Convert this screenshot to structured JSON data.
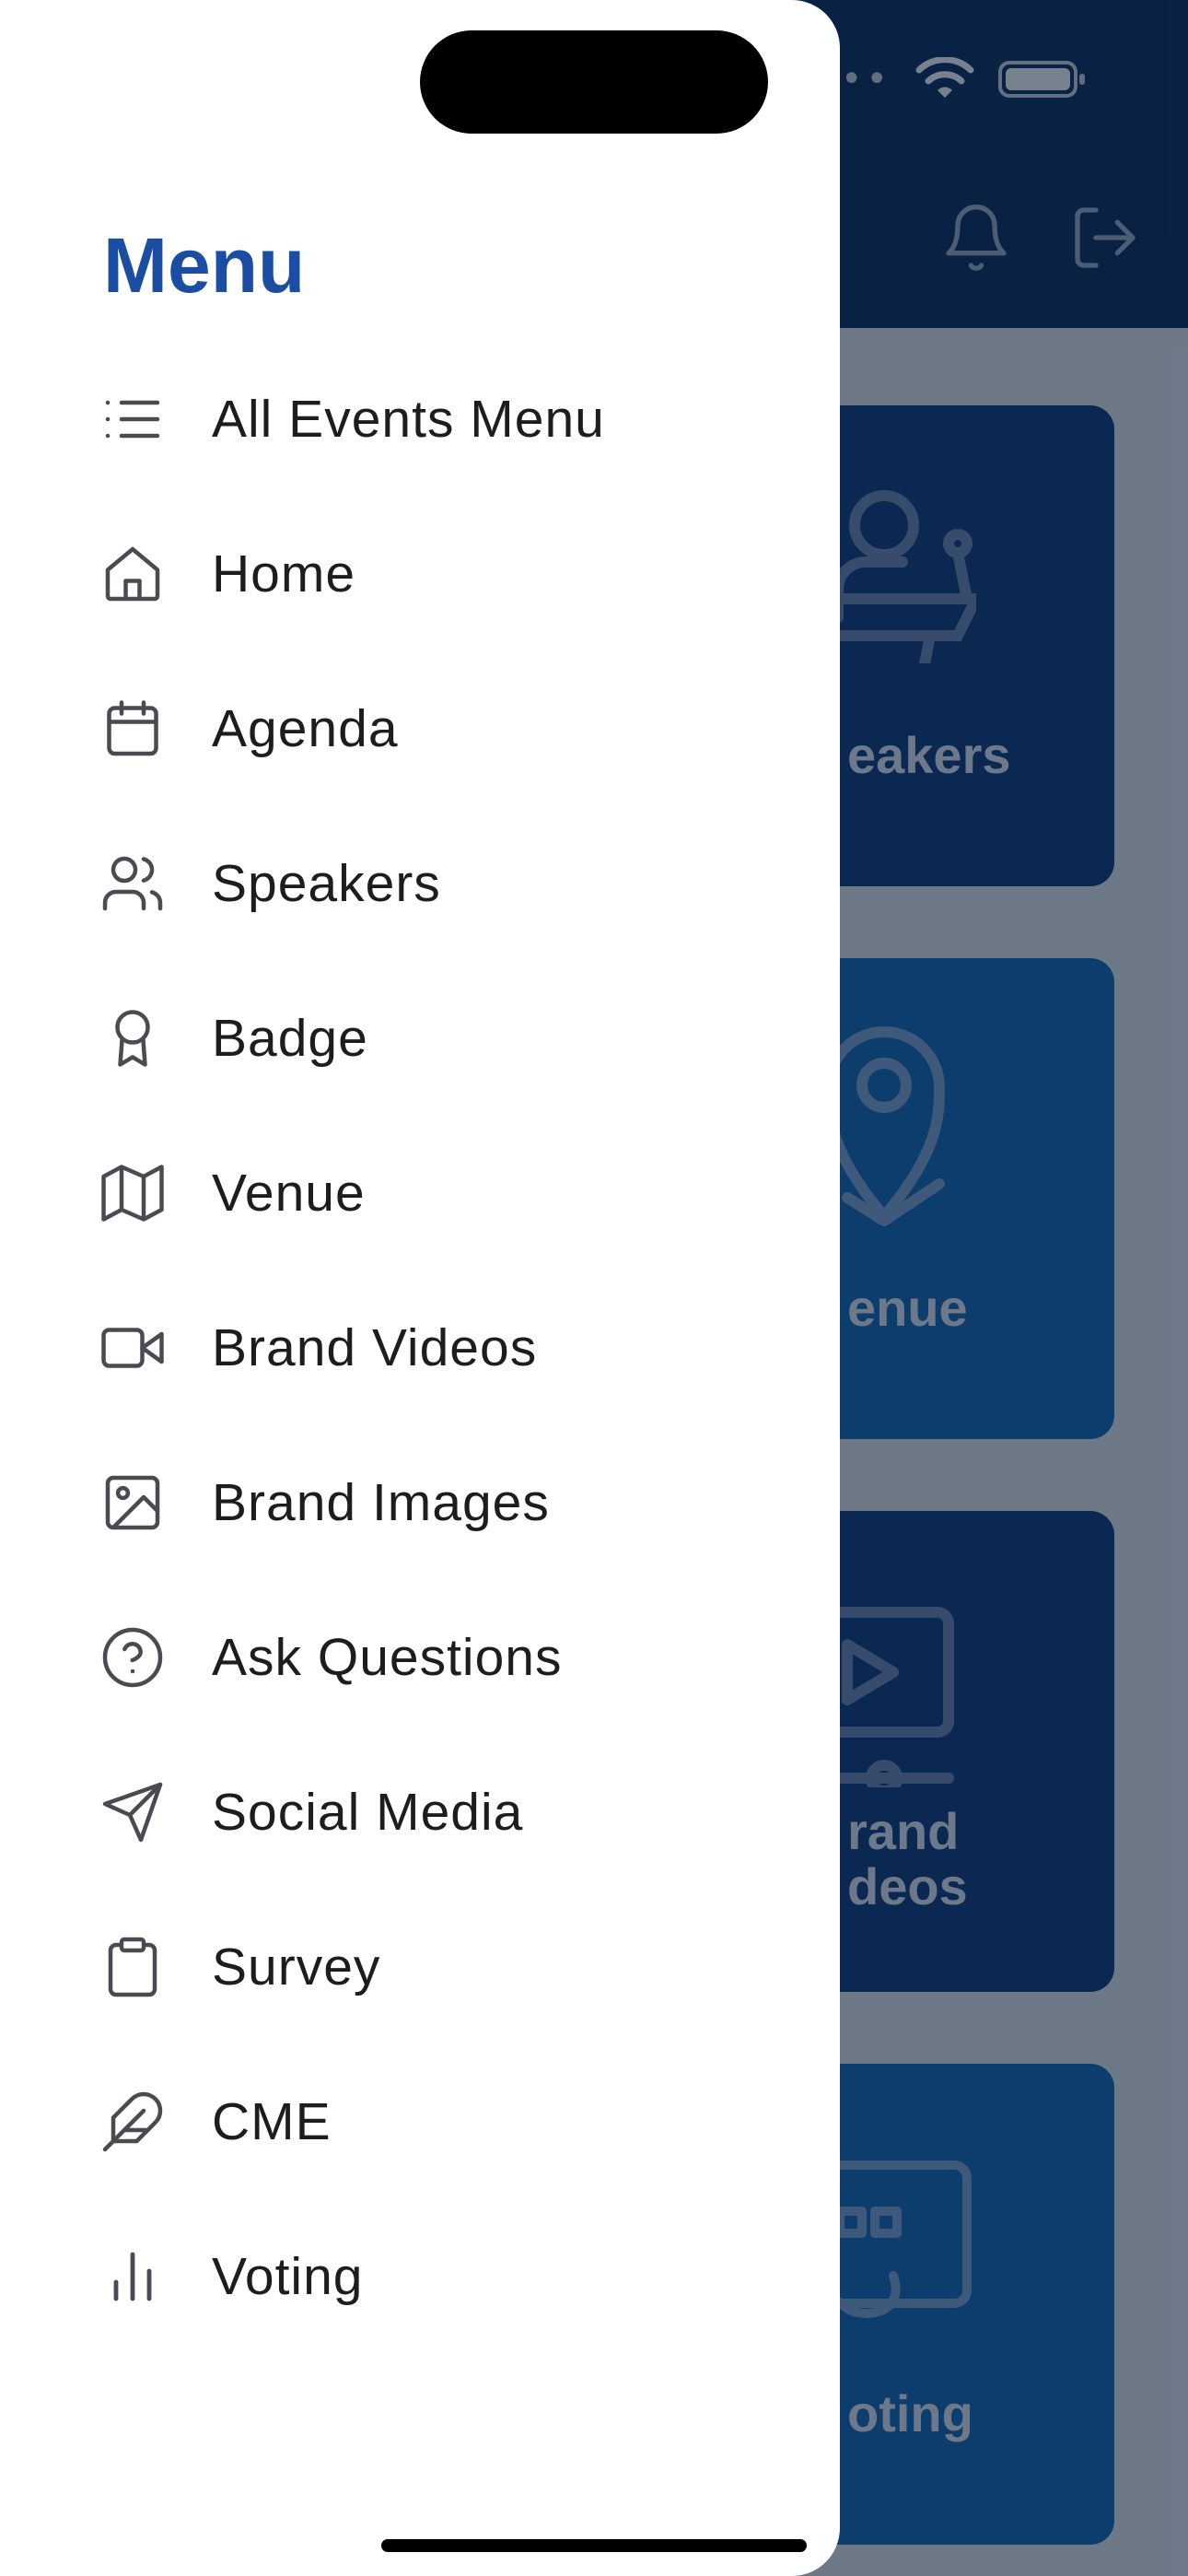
{
  "menu": {
    "title": "Menu",
    "items": [
      {
        "label": "All Events Menu",
        "icon": "list-icon"
      },
      {
        "label": "Home",
        "icon": "home-icon"
      },
      {
        "label": "Agenda",
        "icon": "calendar-icon"
      },
      {
        "label": "Speakers",
        "icon": "users-icon"
      },
      {
        "label": "Badge",
        "icon": "award-icon"
      },
      {
        "label": "Venue",
        "icon": "map-icon"
      },
      {
        "label": "Brand Videos",
        "icon": "video-icon"
      },
      {
        "label": "Brand Images",
        "icon": "image-icon"
      },
      {
        "label": "Ask Questions",
        "icon": "help-circle-icon"
      },
      {
        "label": "Social Media",
        "icon": "send-icon"
      },
      {
        "label": "Survey",
        "icon": "clipboard-icon"
      },
      {
        "label": "CME",
        "icon": "feather-icon"
      },
      {
        "label": "Voting",
        "icon": "bar-chart-icon"
      }
    ]
  },
  "background": {
    "tiles": [
      {
        "label": "eakers",
        "color": "#0d3a78"
      },
      {
        "label": "enue",
        "color": "#1168b3"
      },
      {
        "label_line1": "rand",
        "label_line2": "deos",
        "color": "#0d3a78"
      },
      {
        "label": "oting",
        "color": "#1168b3"
      }
    ]
  },
  "colors": {
    "menu_title": "#1b4ea3",
    "header": "#0b2e5b",
    "menu_text": "#1d1d1f",
    "icon_stroke": "#4a4a52"
  }
}
